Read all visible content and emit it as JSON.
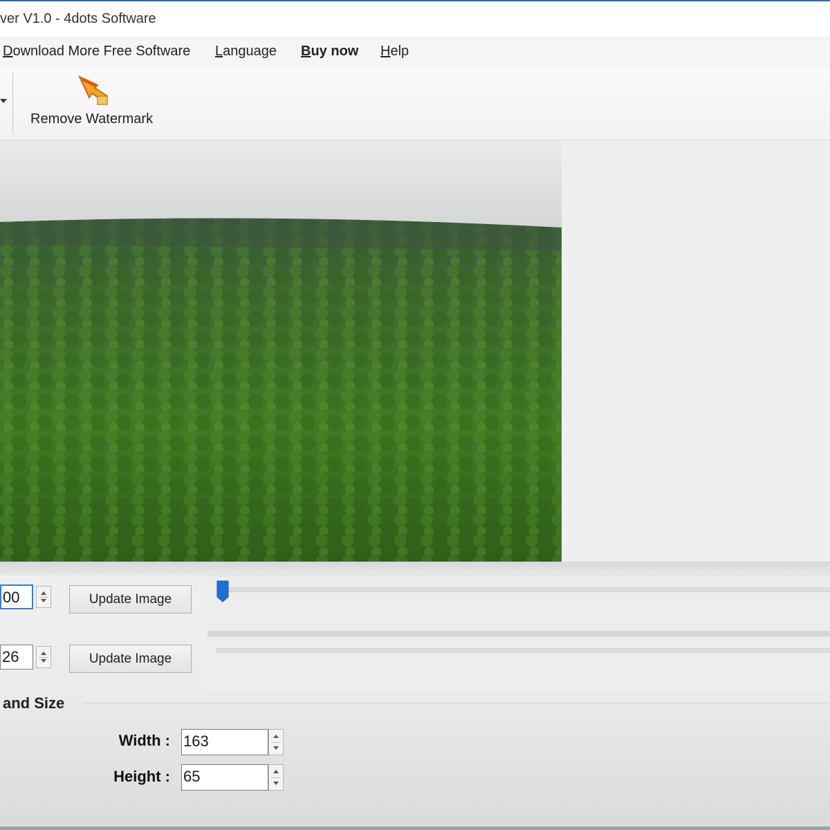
{
  "window": {
    "title": "ver V1.0 - 4dots Software"
  },
  "menu": {
    "download": {
      "first": "D",
      "rest": "ownload More Free Software"
    },
    "language": {
      "first": "L",
      "rest": "anguage"
    },
    "buy": {
      "first": "B",
      "rest": "uy now"
    },
    "help": {
      "first": "H",
      "rest": "elp"
    }
  },
  "toolbar": {
    "remove_watermark_label": "Remove Watermark"
  },
  "controls": {
    "row1": {
      "value": "00",
      "button_label": "Update Image",
      "slider_level": 0.0
    },
    "row2": {
      "value": "26",
      "button_label": "Update Image"
    }
  },
  "group": {
    "label": "and Size",
    "width_label": "Width :",
    "width_value": "163",
    "height_label": "Height :",
    "height_value": "65"
  },
  "colors": {
    "accent": "#2f7fd6",
    "thumb": "#1e6fd9"
  }
}
